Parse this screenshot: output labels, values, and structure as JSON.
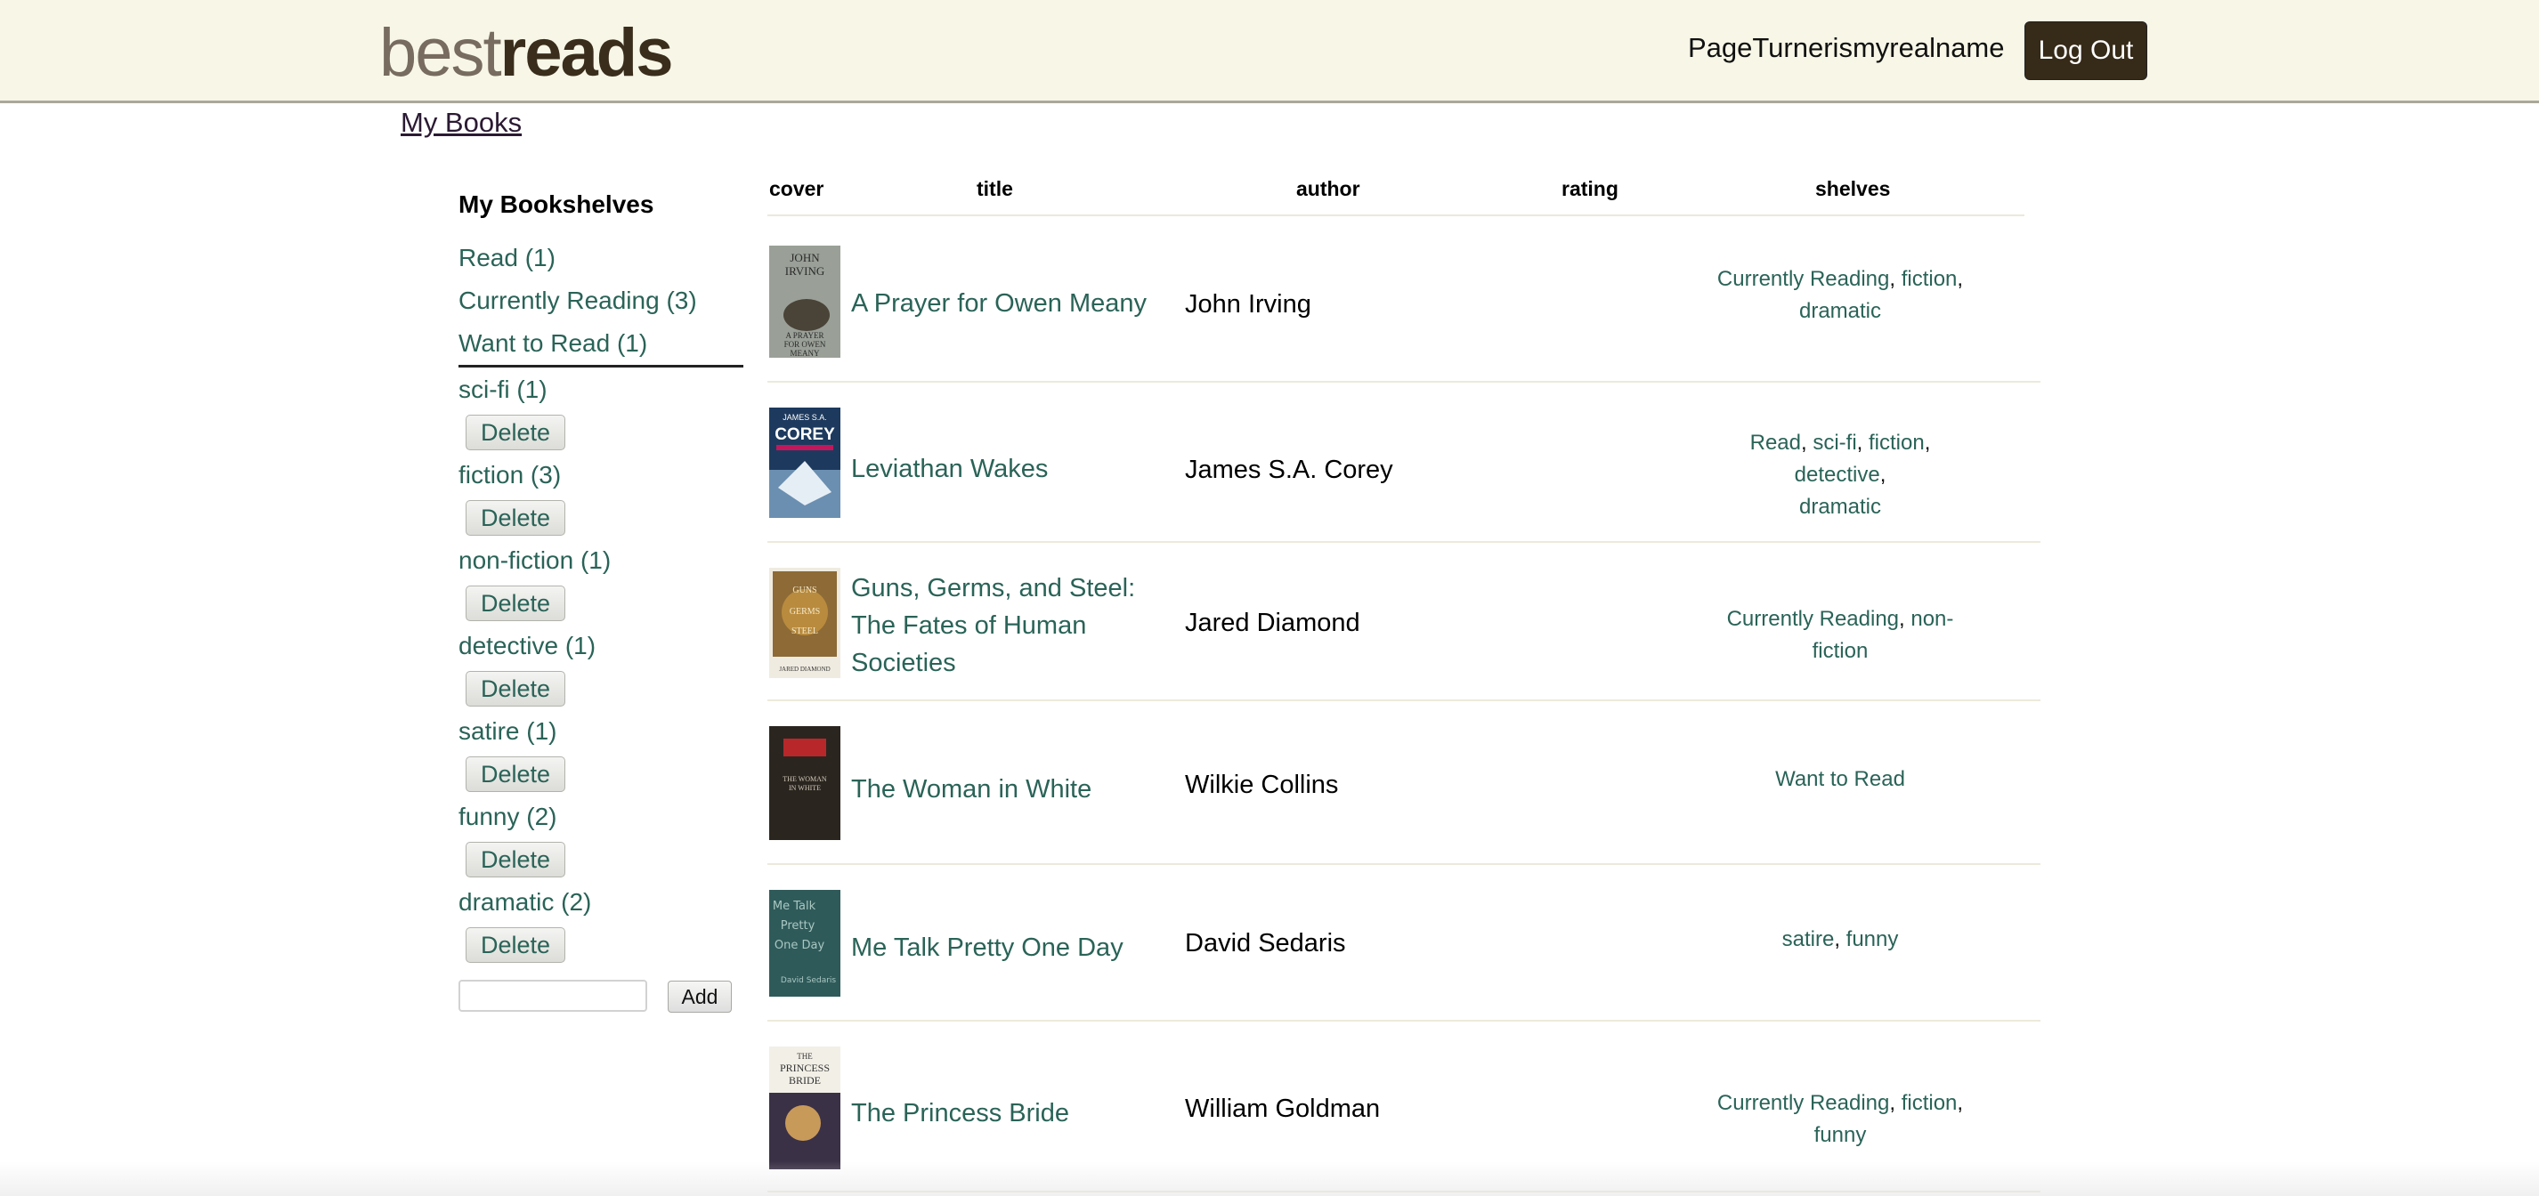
{
  "header": {
    "logo_light": "best",
    "logo_dark": "reads",
    "username": "PageTurnerismyrealname",
    "logout_label": "Log Out"
  },
  "nav": {
    "my_books": "My Books"
  },
  "sidebar": {
    "title": "My Bookshelves",
    "default_shelves": [
      "Read (1)",
      "Currently Reading (3)",
      "Want to Read (1)"
    ],
    "custom_shelves": [
      "sci-fi (1)",
      "fiction (3)",
      "non-fiction (1)",
      "detective (1)",
      "satire (1)",
      "funny (2)",
      "dramatic (2)"
    ],
    "delete_label": "Delete",
    "add_label": "Add",
    "new_shelf_value": ""
  },
  "table": {
    "columns": [
      "cover",
      "title",
      "author",
      "rating",
      "shelves"
    ],
    "rows": [
      {
        "title": "A Prayer for Owen Meany",
        "author": "John Irving",
        "rating": "",
        "shelves": [
          "Currently Reading",
          "fiction",
          "dramatic"
        ]
      },
      {
        "title": "Leviathan Wakes",
        "author": "James S.A. Corey",
        "rating": "",
        "shelves": [
          "Read",
          "sci-fi",
          "fiction",
          "detective",
          "dramatic"
        ]
      },
      {
        "title": "Guns, Germs, and Steel: The Fates of Human Societies",
        "author": "Jared Diamond",
        "rating": "",
        "shelves": [
          "Currently Reading",
          "non-fiction"
        ]
      },
      {
        "title": "The Woman in White",
        "author": "Wilkie Collins",
        "rating": "",
        "shelves": [
          "Want to Read"
        ]
      },
      {
        "title": "Me Talk Pretty One Day",
        "author": "David Sedaris",
        "rating": "",
        "shelves": [
          "satire",
          "funny"
        ]
      },
      {
        "title": "The Princess Bride",
        "author": "William Goldman",
        "rating": "",
        "shelves": [
          "Currently Reading",
          "fiction",
          "funny"
        ]
      }
    ]
  },
  "covers": [
    {
      "lines": [
        "JOHN",
        "IRVING",
        "A PRAYER",
        "FOR OWEN",
        "MEANY"
      ]
    },
    {
      "lines": [
        "JAMES S.A.",
        "COREY"
      ]
    },
    {
      "lines": [
        "GUNS",
        "GERMS",
        "STEEL",
        "JARED DIAMOND"
      ]
    },
    {
      "lines": [
        "THE WOMAN",
        "IN WHITE"
      ]
    },
    {
      "lines": [
        "Me Talk",
        "Pretty",
        "One Day",
        "David Sedaris"
      ]
    },
    {
      "lines": [
        "THE",
        "PRINCESS",
        "BRIDE"
      ]
    }
  ],
  "colors": {
    "header_bg": "#f7f6e7",
    "link": "#2a6357",
    "logout_bg": "#362a18"
  }
}
